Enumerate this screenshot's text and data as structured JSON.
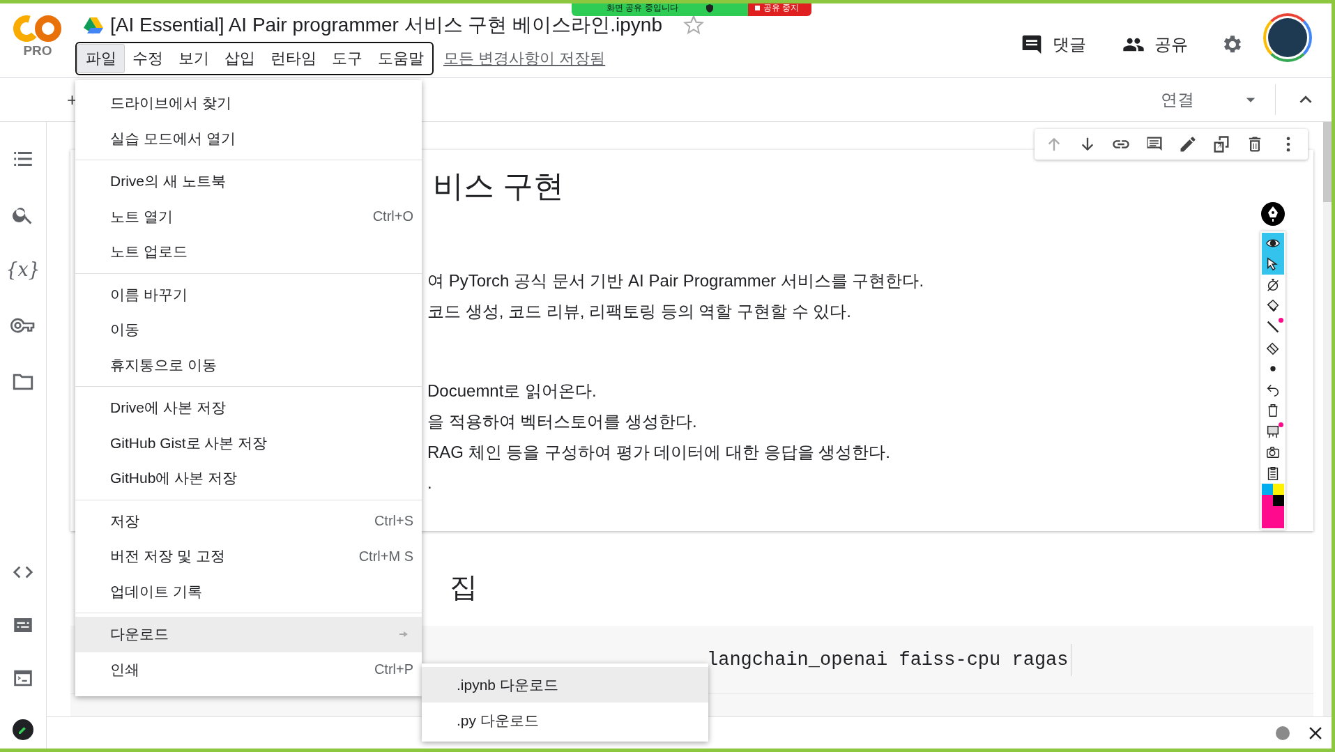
{
  "screen_share": {
    "status": "화면 공유 중입니다",
    "stop": "공유 중지"
  },
  "header": {
    "logo_text": "PRO",
    "title": "[AI Essential] AI Pair programmer 서비스 구현 베이스라인.ipynb",
    "menu": [
      {
        "label": "파일",
        "selected": true
      },
      {
        "label": "수정",
        "selected": false
      },
      {
        "label": "보기",
        "selected": false
      },
      {
        "label": "삽입",
        "selected": false
      },
      {
        "label": "런타임",
        "selected": false
      },
      {
        "label": "도구",
        "selected": false
      },
      {
        "label": "도움말",
        "selected": false
      }
    ],
    "save_status": "모든 변경사항이 저장됨",
    "comments": "댓글",
    "share": "공유"
  },
  "toolbar": {
    "add": "+",
    "connect": "연결"
  },
  "sidebar": {
    "variables": "{x}"
  },
  "file_menu": [
    [
      {
        "label": "드라이브에서 찾기",
        "selected": false
      },
      {
        "label": "실습 모드에서 열기",
        "selected": false
      }
    ],
    [
      {
        "label": "Drive의 새 노트북",
        "selected": false
      },
      {
        "label": "노트 열기",
        "shortcut": "Ctrl+O",
        "selected": false
      },
      {
        "label": "노트 업로드",
        "selected": false
      }
    ],
    [
      {
        "label": "이름 바꾸기",
        "selected": false
      },
      {
        "label": "이동",
        "selected": false
      },
      {
        "label": "휴지통으로 이동",
        "selected": false
      }
    ],
    [
      {
        "label": "Drive에 사본 저장",
        "selected": false
      },
      {
        "label": "GitHub Gist로 사본 저장",
        "selected": false
      },
      {
        "label": "GitHub에 사본 저장",
        "selected": false
      }
    ],
    [
      {
        "label": "저장",
        "shortcut": "Ctrl+S",
        "selected": false
      },
      {
        "label": "버전 저장 및 고정",
        "shortcut": "Ctrl+M S",
        "selected": false
      },
      {
        "label": "업데이트 기록",
        "selected": false
      }
    ],
    [
      {
        "label": "다운로드",
        "submenu": true,
        "selected": true
      },
      {
        "label": "인쇄",
        "shortcut": "Ctrl+P",
        "selected": false
      }
    ]
  ],
  "download_submenu": [
    {
      "label": ".ipynb 다운로드",
      "selected": true
    },
    {
      "label": ".py 다운로드",
      "selected": false
    }
  ],
  "cell_toolbar": [
    {
      "kind": "up",
      "disabled": true
    },
    {
      "kind": "down",
      "disabled": false
    },
    {
      "kind": "link",
      "disabled": false
    },
    {
      "kind": "comment",
      "disabled": false
    },
    {
      "kind": "edit",
      "disabled": false
    },
    {
      "kind": "mirror",
      "disabled": false
    },
    {
      "kind": "delete",
      "disabled": false
    },
    {
      "kind": "more",
      "disabled": false
    }
  ],
  "notebook": {
    "heading1": "비스 구현",
    "paragraph_groups": [
      [
        "여 PyTorch 공식 문서 기반 AI Pair Programmer 서비스를 구현한다.",
        "코드 생성, 코드 리뷰, 리팩토링 등의 역할 구현할 수 있다."
      ],
      [
        "Docuemnt로 읽어온다.",
        "을 적용하여 벡터스토어를 생성한다.",
        "RAG 체인 등을 구성하여 평가 데이터에 대한 응답을 생성한다.",
        "."
      ]
    ],
    "heading2": "집",
    "code": "langchain_openai faiss-cpu ragas"
  },
  "annotation_tools": [
    {
      "kind": "eye",
      "selected": true,
      "badge": false
    },
    {
      "kind": "pointer",
      "selected": true,
      "badge": false
    },
    {
      "kind": "timer",
      "selected": false,
      "badge": false
    },
    {
      "kind": "highlighter",
      "selected": false,
      "badge": false
    },
    {
      "kind": "line",
      "selected": false,
      "badge": true
    },
    {
      "kind": "eraser",
      "selected": false,
      "badge": false
    },
    {
      "kind": "dot",
      "selected": false,
      "badge": false
    },
    {
      "kind": "undo",
      "selected": false,
      "badge": false
    },
    {
      "kind": "trash",
      "selected": false,
      "badge": false
    },
    {
      "kind": "board",
      "selected": false,
      "badge": true
    },
    {
      "kind": "camera",
      "selected": false,
      "badge": false
    },
    {
      "kind": "clipboard",
      "selected": false,
      "badge": false
    }
  ],
  "palette": [
    {
      "color": "#00aeef",
      "kind": "small"
    },
    {
      "color": "#fff200",
      "kind": "small"
    },
    {
      "color": "#ff0a8c",
      "kind": "small"
    },
    {
      "color": "#000000",
      "kind": "small"
    },
    {
      "color": "#ff0a8c",
      "kind": "large"
    }
  ]
}
